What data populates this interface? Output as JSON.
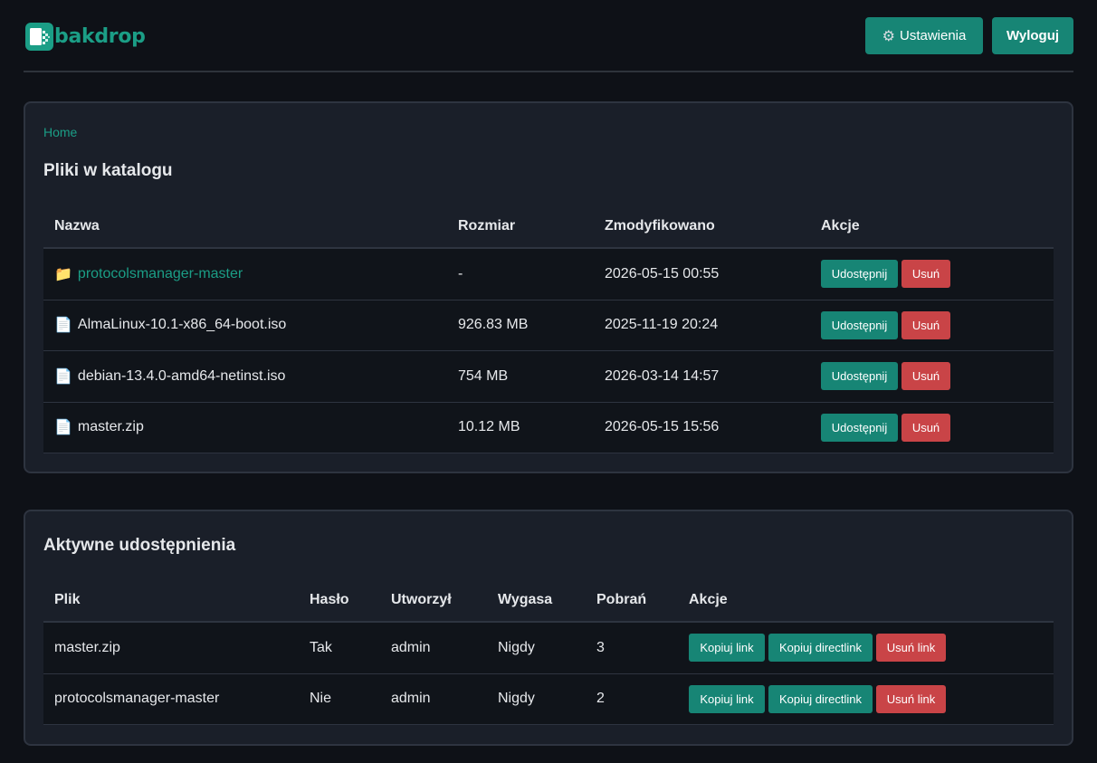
{
  "header": {
    "logo_text": "bakdrop",
    "settings_label": "Ustawienia",
    "logout_label": "Wyloguj",
    "accent_color": "#1b9e86"
  },
  "files_panel": {
    "breadcrumb": "Home",
    "title": "Pliki w katalogu",
    "columns": [
      "Nazwa",
      "Rozmiar",
      "Zmodyfikowano",
      "Akcje"
    ],
    "rows": [
      {
        "icon": "folder-icon",
        "name": "protocolsmanager-master",
        "size": "-",
        "modified": "2026-05-15 00:55"
      },
      {
        "icon": "file-icon",
        "name": "AlmaLinux-10.1-x86_64-boot.iso",
        "size": "926.83 MB",
        "modified": "2025-11-19 20:24"
      },
      {
        "icon": "file-icon",
        "name": "debian-13.4.0-amd64-netinst.iso",
        "size": "754 MB",
        "modified": "2026-03-14 14:57"
      },
      {
        "icon": "file-icon",
        "name": "master.zip",
        "size": "10.12 MB",
        "modified": "2026-05-15 15:56"
      }
    ],
    "share_label": "Udostępnij",
    "delete_label": "Usuń"
  },
  "shares_panel": {
    "title": "Aktywne udostępnienia",
    "columns": [
      "Plik",
      "Hasło",
      "Utworzył",
      "Wygasa",
      "Pobrań",
      "Akcje"
    ],
    "rows": [
      {
        "file": "master.zip",
        "password": "Tak",
        "created_by": "admin",
        "expires": "Nigdy",
        "downloads": "3"
      },
      {
        "file": "protocolsmanager-master",
        "password": "Nie",
        "created_by": "admin",
        "expires": "Nigdy",
        "downloads": "2"
      }
    ],
    "copy_label": "Kopiuj link",
    "copy_direct_label": "Kopiuj directlink",
    "delete_link_label": "Usuń link"
  }
}
